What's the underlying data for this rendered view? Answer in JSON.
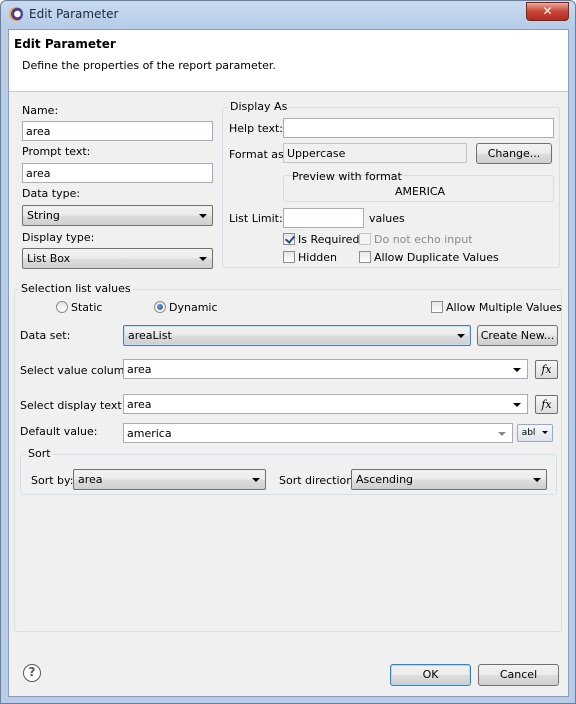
{
  "window": {
    "title": "Edit Parameter",
    "close_glyph": "✕"
  },
  "header": {
    "title": "Edit Parameter",
    "description": "Define the properties of the report parameter."
  },
  "left": {
    "name_label": "Name:",
    "name_value": "area",
    "prompt_label": "Prompt text:",
    "prompt_value": "area",
    "data_type_label": "Data type:",
    "data_type_value": "String",
    "display_type_label": "Display type:",
    "display_type_value": "List Box"
  },
  "display_as": {
    "title": "Display As",
    "help_label": "Help text:",
    "help_value": "",
    "format_label": "Format as:",
    "format_value": "Uppercase",
    "change_button": "Change...",
    "preview_title": "Preview with format",
    "preview_value": "AMERICA",
    "list_limit_label": "List Limit:",
    "list_limit_value": "",
    "values_label": "values",
    "is_required_label": "Is Required",
    "is_required_checked": true,
    "no_echo_label": "Do not echo input",
    "hidden_label": "Hidden",
    "allow_duplicates_label": "Allow Duplicate Values"
  },
  "selection": {
    "title": "Selection list values",
    "static_label": "Static",
    "dynamic_label": "Dynamic",
    "selected_mode": "Dynamic",
    "allow_multiple_label": "Allow Multiple Values",
    "dataset_label": "Data set:",
    "dataset_value": "areaList",
    "create_new_button": "Create New...",
    "value_column_label": "Select value column:",
    "value_column_value": "area",
    "display_text_label": "Select display text:",
    "display_text_value": "area",
    "default_value_label": "Default value:",
    "default_value_value": "america",
    "fx_glyph": "fx",
    "abl_glyph": "abl"
  },
  "sort": {
    "title": "Sort",
    "sort_by_label": "Sort by:",
    "sort_by_value": "area",
    "sort_direction_label": "Sort direction:",
    "sort_direction_value": "Ascending"
  },
  "footer": {
    "help_glyph": "?",
    "ok_button": "OK",
    "cancel_button": "Cancel"
  }
}
